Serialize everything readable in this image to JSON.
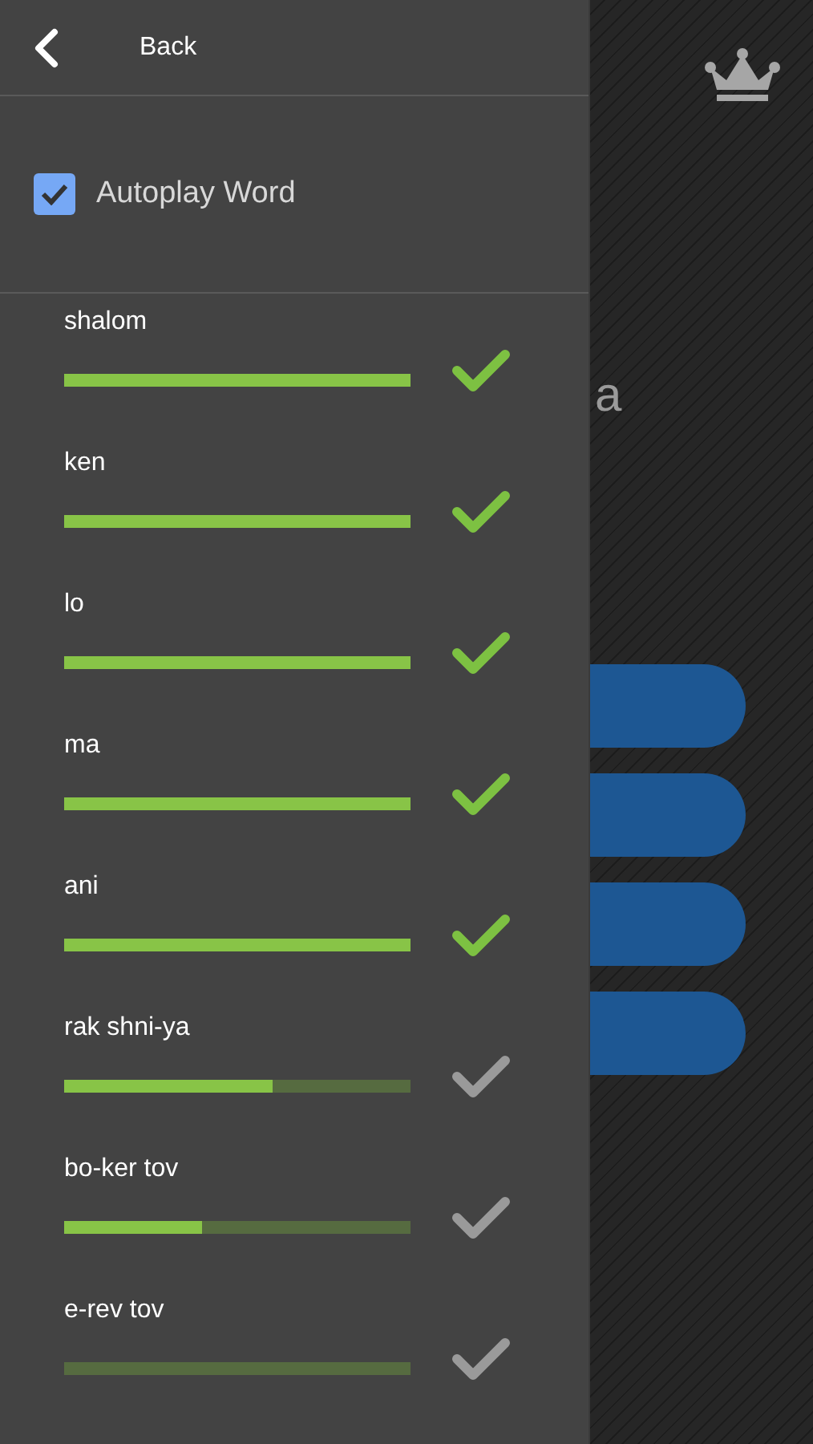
{
  "header": {
    "back_label": "Back"
  },
  "autoplay": {
    "label": "Autoplay Word",
    "checked": true
  },
  "words": [
    {
      "word": "shalom",
      "level": 1,
      "learned": true
    },
    {
      "word": "ken",
      "level": 1,
      "learned": true
    },
    {
      "word": "lo",
      "level": 1,
      "learned": true
    },
    {
      "word": "ma",
      "level": 1,
      "learned": true
    },
    {
      "word": "ani",
      "level": 1,
      "learned": true
    },
    {
      "word": "rak shni-ya",
      "level": 0.6,
      "learned": false
    },
    {
      "word": "bo-ker tov",
      "level": 0.4,
      "learned": false
    },
    {
      "word": "e-rev tov",
      "level": 0,
      "learned": false
    }
  ],
  "background": {
    "title_fragment": "a"
  }
}
